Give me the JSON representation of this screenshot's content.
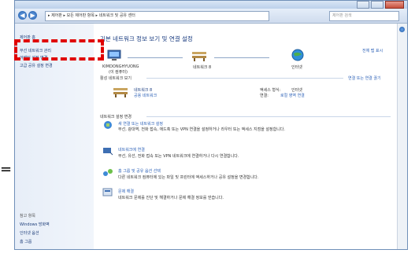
{
  "window": {
    "path": "▸ 제어판 ▸ 모든 제어판 항목 ▸ 네트워크 및 공유 센터",
    "search_placeholder": "제어판 검색"
  },
  "sidebar": {
    "items": [
      {
        "label": "제어판 홈"
      },
      {
        "label": "무선 네트워크 관리"
      },
      {
        "label": "어댑터 설정 변경"
      },
      {
        "label": "고급 공유 설정 변경"
      }
    ],
    "see_also": [
      {
        "label": "참고 항목"
      },
      {
        "label": "Windows 방화벽"
      },
      {
        "label": "인터넷 옵션"
      },
      {
        "label": "홈 그룹"
      }
    ]
  },
  "main": {
    "title": "기본 네트워크 정보 보기 및 연결 설정",
    "view_full_map": "전체 맵 표시",
    "nodes": [
      {
        "label": "KIMDONGHYUONG",
        "sub": "(이 컴퓨터)"
      },
      {
        "label": "네트워크 8",
        "sub": ""
      },
      {
        "label": "인터넷",
        "sub": ""
      }
    ],
    "active_networks_label": "활성 네트워크 보기",
    "connect_disconnect": "연결 또는 연결 끊기",
    "network_name": "네트워크 8",
    "network_type": "공용 네트워크",
    "access_type_label": "액세스 형식:",
    "access_type_value": "인터넷",
    "connections_label": "연결:",
    "connections_value": "로컬 영역 연결",
    "change_settings_label": "네트워크 설정 변경",
    "tasks": [
      {
        "title": "새 연결 또는 네트워크 설정",
        "desc": "무선, 광대역, 전화 접속, 애드혹 또는 VPN 연결을 설정하거나 라우터 또는 액세스 지점을 설정합니다."
      },
      {
        "title": "네트워크에 연결",
        "desc": "무선, 유선, 전화 접속 또는 VPN 네트워크에 연결하거나 다시 연결합니다."
      },
      {
        "title": "홈 그룹 및 공유 옵션 선택",
        "desc": "다른 네트워크 컴퓨터에 있는 파일 및 프린터에 액세스하거나 공유 설정을 변경합니다."
      },
      {
        "title": "문제 해결",
        "desc": "네트워크 문제를 진단 및 해결하거나 문제 해결 정보를 얻습니다."
      }
    ]
  },
  "annotation": {
    "arrow": "="
  },
  "colors": {
    "highlight": "#e00000",
    "link": "#2f63b8",
    "title": "#1b3d80"
  }
}
